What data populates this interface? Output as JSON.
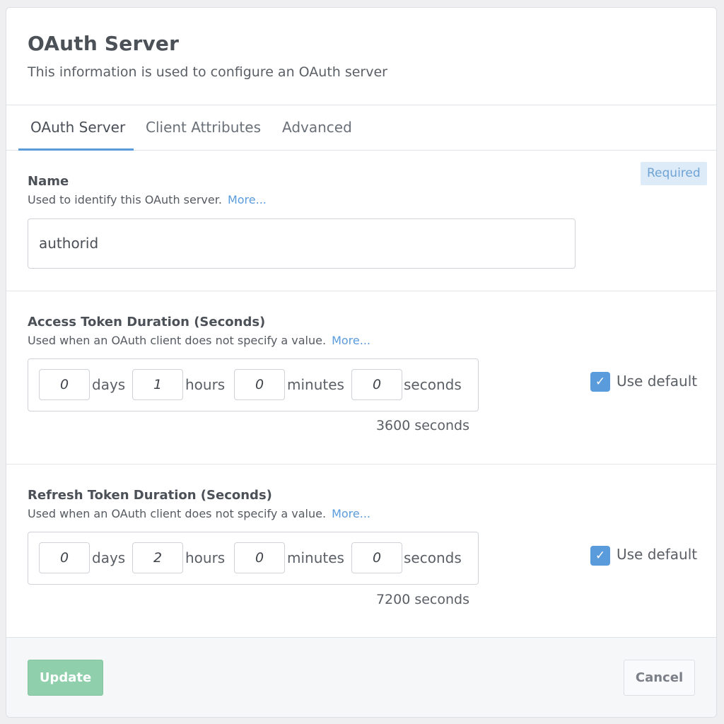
{
  "header": {
    "title": "OAuth Server",
    "subtitle": "This information is used to configure an OAuth server"
  },
  "tabs": [
    {
      "label": "OAuth Server",
      "active": true
    },
    {
      "label": "Client Attributes",
      "active": false
    },
    {
      "label": "Advanced",
      "active": false
    }
  ],
  "name_field": {
    "label": "Name",
    "description": "Used to identify this OAuth server.",
    "more": "More...",
    "required": "Required",
    "value": "authorid"
  },
  "access_token": {
    "label": "Access Token Duration (Seconds)",
    "description": "Used when an OAuth client does not specify a value.",
    "more": "More...",
    "days": "0",
    "hours": "1",
    "minutes": "0",
    "seconds": "0",
    "total": "3600 seconds",
    "use_default_label": "Use default",
    "use_default": true
  },
  "refresh_token": {
    "label": "Refresh Token Duration (Seconds)",
    "description": "Used when an OAuth client does not specify a value.",
    "more": "More...",
    "days": "0",
    "hours": "2",
    "minutes": "0",
    "seconds": "0",
    "total": "7200 seconds",
    "use_default_label": "Use default",
    "use_default": true
  },
  "units": {
    "days": "days",
    "hours": "hours",
    "minutes": "minutes",
    "seconds": "seconds"
  },
  "footer": {
    "update_label": "Update",
    "cancel_label": "Cancel"
  },
  "colors": {
    "accent": "#5a9bdc",
    "update_button": "#8fcfac",
    "required_badge_bg": "#ddeaf7"
  },
  "icons": {
    "checkbox": "checkmark-icon"
  }
}
